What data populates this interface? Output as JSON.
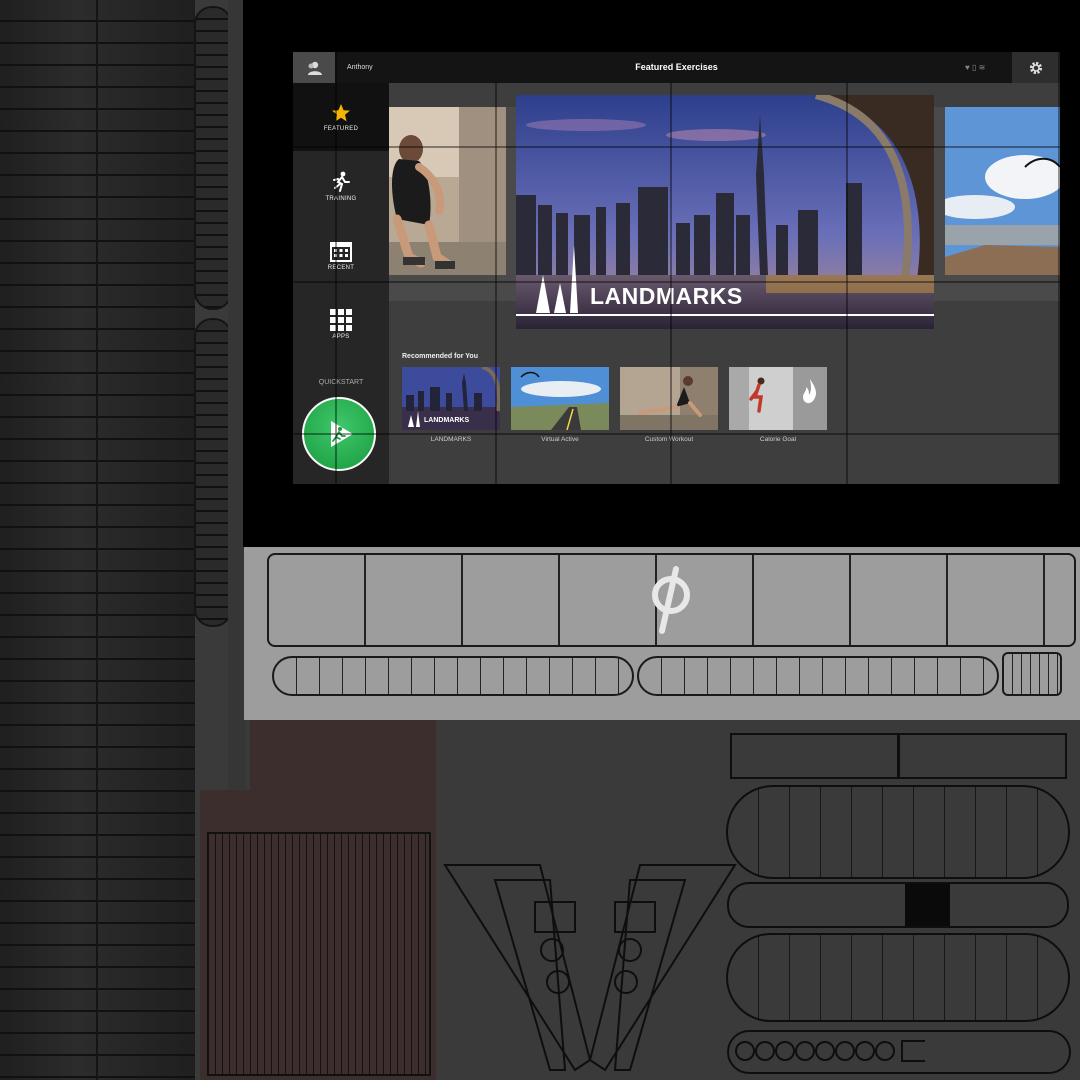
{
  "header": {
    "user_name": "Anthony",
    "title": "Featured Exercises"
  },
  "sidebar": {
    "items": [
      {
        "label": "FEATURED",
        "icon": "star-icon",
        "active": true
      },
      {
        "label": "TRAINING",
        "icon": "runner-icon",
        "active": false
      },
      {
        "label": "RECENT",
        "icon": "calendar-icon",
        "active": false
      },
      {
        "label": "APPS",
        "icon": "apps-grid-icon",
        "active": false
      }
    ],
    "quickstart_label": "QUICKSTART"
  },
  "featured": {
    "main_card_title": "LANDMARKS"
  },
  "recommended": {
    "heading": "Recommended for You",
    "items": [
      {
        "label": "LANDMARKS",
        "badge": "LANDMARKS"
      },
      {
        "label": "Virtual Active"
      },
      {
        "label": "Custom Workout"
      },
      {
        "label": "Calorie Goal"
      }
    ]
  },
  "colors": {
    "quickstart_green": "#22a84a",
    "accent_star": "#f5b400"
  }
}
